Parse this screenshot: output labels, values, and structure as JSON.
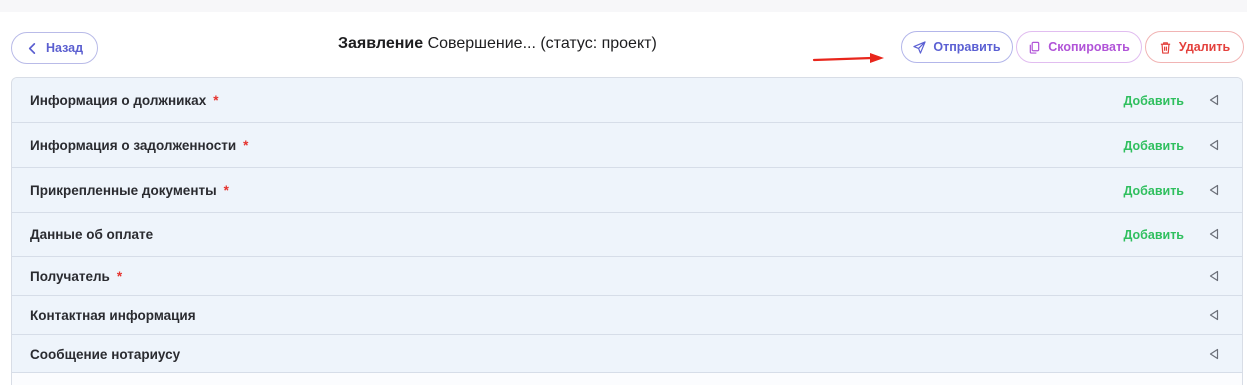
{
  "header": {
    "back_label": "Назад",
    "title_bold": "Заявление",
    "title_rest": " Совершение... (статус: проект)",
    "send_label": "Отправить",
    "copy_label": "Скопировать",
    "delete_label": "Удалить"
  },
  "colors": {
    "primary": "#5b60d3",
    "copy": "#b154d8",
    "danger": "#e4413d",
    "add": "#2fbf5e",
    "required": "#e5322d",
    "row_bg": "#eef4fb",
    "arrow": "#e8261c"
  },
  "sections": [
    {
      "label": "Информация о должниках",
      "required": "*",
      "action": "Добавить"
    },
    {
      "label": "Информация о задолженности",
      "required": "*",
      "action": "Добавить"
    },
    {
      "label": "Прикрепленные документы",
      "required": "*",
      "action": "Добавить"
    },
    {
      "label": "Данные об оплате",
      "required": "",
      "action": "Добавить"
    },
    {
      "label": "Получатель",
      "required": "*",
      "action": ""
    },
    {
      "label": "Контактная информация",
      "required": "",
      "action": ""
    },
    {
      "label": "Сообщение нотариусу",
      "required": "",
      "action": ""
    }
  ]
}
